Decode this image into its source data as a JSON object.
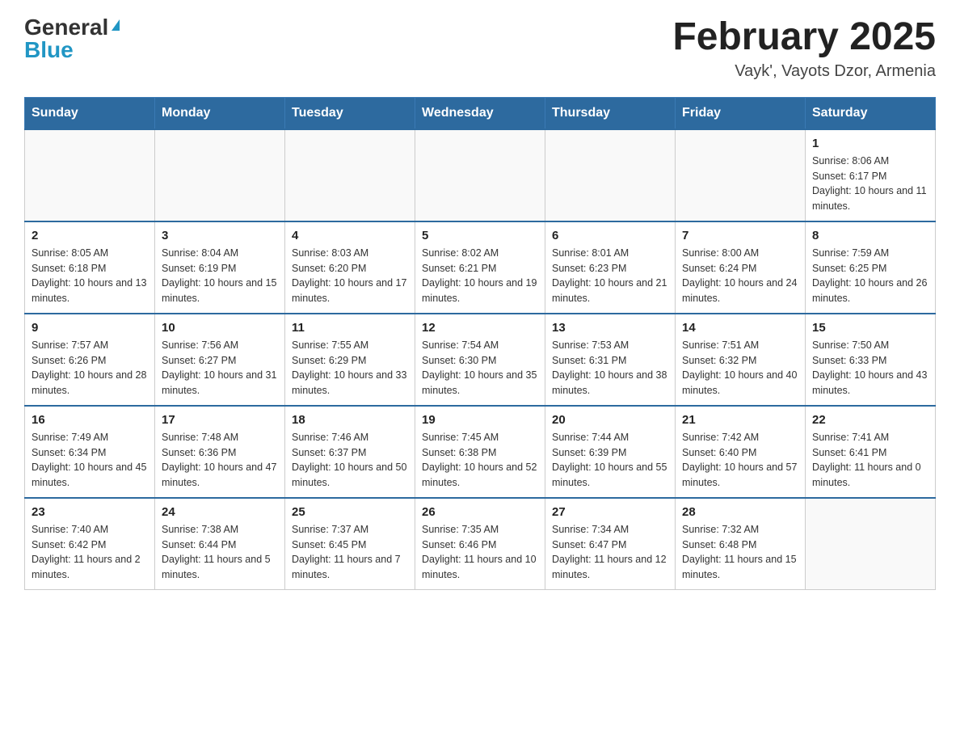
{
  "header": {
    "logo_general": "General",
    "logo_blue": "Blue",
    "title": "February 2025",
    "location": "Vayk', Vayots Dzor, Armenia"
  },
  "weekdays": [
    "Sunday",
    "Monday",
    "Tuesday",
    "Wednesday",
    "Thursday",
    "Friday",
    "Saturday"
  ],
  "weeks": [
    [
      {
        "day": "",
        "info": ""
      },
      {
        "day": "",
        "info": ""
      },
      {
        "day": "",
        "info": ""
      },
      {
        "day": "",
        "info": ""
      },
      {
        "day": "",
        "info": ""
      },
      {
        "day": "",
        "info": ""
      },
      {
        "day": "1",
        "info": "Sunrise: 8:06 AM\nSunset: 6:17 PM\nDaylight: 10 hours and 11 minutes."
      }
    ],
    [
      {
        "day": "2",
        "info": "Sunrise: 8:05 AM\nSunset: 6:18 PM\nDaylight: 10 hours and 13 minutes."
      },
      {
        "day": "3",
        "info": "Sunrise: 8:04 AM\nSunset: 6:19 PM\nDaylight: 10 hours and 15 minutes."
      },
      {
        "day": "4",
        "info": "Sunrise: 8:03 AM\nSunset: 6:20 PM\nDaylight: 10 hours and 17 minutes."
      },
      {
        "day": "5",
        "info": "Sunrise: 8:02 AM\nSunset: 6:21 PM\nDaylight: 10 hours and 19 minutes."
      },
      {
        "day": "6",
        "info": "Sunrise: 8:01 AM\nSunset: 6:23 PM\nDaylight: 10 hours and 21 minutes."
      },
      {
        "day": "7",
        "info": "Sunrise: 8:00 AM\nSunset: 6:24 PM\nDaylight: 10 hours and 24 minutes."
      },
      {
        "day": "8",
        "info": "Sunrise: 7:59 AM\nSunset: 6:25 PM\nDaylight: 10 hours and 26 minutes."
      }
    ],
    [
      {
        "day": "9",
        "info": "Sunrise: 7:57 AM\nSunset: 6:26 PM\nDaylight: 10 hours and 28 minutes."
      },
      {
        "day": "10",
        "info": "Sunrise: 7:56 AM\nSunset: 6:27 PM\nDaylight: 10 hours and 31 minutes."
      },
      {
        "day": "11",
        "info": "Sunrise: 7:55 AM\nSunset: 6:29 PM\nDaylight: 10 hours and 33 minutes."
      },
      {
        "day": "12",
        "info": "Sunrise: 7:54 AM\nSunset: 6:30 PM\nDaylight: 10 hours and 35 minutes."
      },
      {
        "day": "13",
        "info": "Sunrise: 7:53 AM\nSunset: 6:31 PM\nDaylight: 10 hours and 38 minutes."
      },
      {
        "day": "14",
        "info": "Sunrise: 7:51 AM\nSunset: 6:32 PM\nDaylight: 10 hours and 40 minutes."
      },
      {
        "day": "15",
        "info": "Sunrise: 7:50 AM\nSunset: 6:33 PM\nDaylight: 10 hours and 43 minutes."
      }
    ],
    [
      {
        "day": "16",
        "info": "Sunrise: 7:49 AM\nSunset: 6:34 PM\nDaylight: 10 hours and 45 minutes."
      },
      {
        "day": "17",
        "info": "Sunrise: 7:48 AM\nSunset: 6:36 PM\nDaylight: 10 hours and 47 minutes."
      },
      {
        "day": "18",
        "info": "Sunrise: 7:46 AM\nSunset: 6:37 PM\nDaylight: 10 hours and 50 minutes."
      },
      {
        "day": "19",
        "info": "Sunrise: 7:45 AM\nSunset: 6:38 PM\nDaylight: 10 hours and 52 minutes."
      },
      {
        "day": "20",
        "info": "Sunrise: 7:44 AM\nSunset: 6:39 PM\nDaylight: 10 hours and 55 minutes."
      },
      {
        "day": "21",
        "info": "Sunrise: 7:42 AM\nSunset: 6:40 PM\nDaylight: 10 hours and 57 minutes."
      },
      {
        "day": "22",
        "info": "Sunrise: 7:41 AM\nSunset: 6:41 PM\nDaylight: 11 hours and 0 minutes."
      }
    ],
    [
      {
        "day": "23",
        "info": "Sunrise: 7:40 AM\nSunset: 6:42 PM\nDaylight: 11 hours and 2 minutes."
      },
      {
        "day": "24",
        "info": "Sunrise: 7:38 AM\nSunset: 6:44 PM\nDaylight: 11 hours and 5 minutes."
      },
      {
        "day": "25",
        "info": "Sunrise: 7:37 AM\nSunset: 6:45 PM\nDaylight: 11 hours and 7 minutes."
      },
      {
        "day": "26",
        "info": "Sunrise: 7:35 AM\nSunset: 6:46 PM\nDaylight: 11 hours and 10 minutes."
      },
      {
        "day": "27",
        "info": "Sunrise: 7:34 AM\nSunset: 6:47 PM\nDaylight: 11 hours and 12 minutes."
      },
      {
        "day": "28",
        "info": "Sunrise: 7:32 AM\nSunset: 6:48 PM\nDaylight: 11 hours and 15 minutes."
      },
      {
        "day": "",
        "info": ""
      }
    ]
  ]
}
